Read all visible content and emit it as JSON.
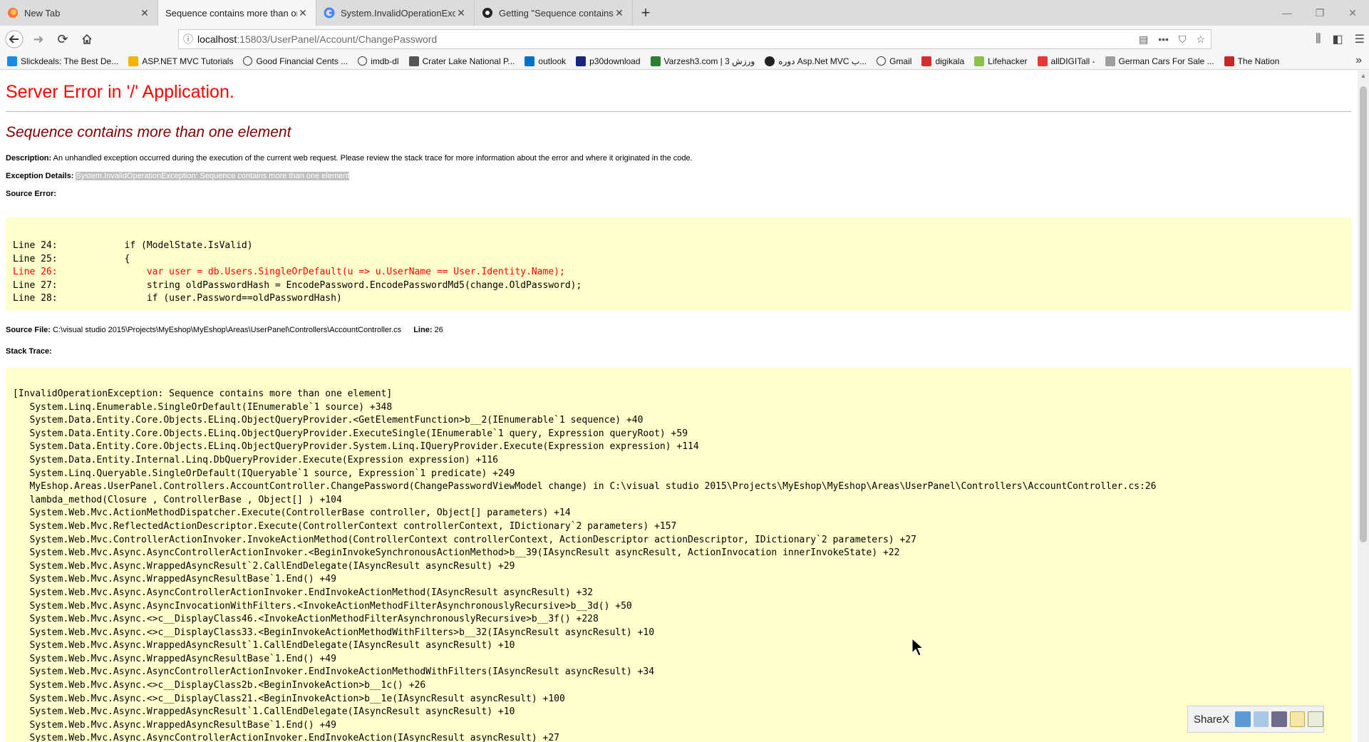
{
  "browser": {
    "tabs": [
      {
        "label": "New Tab",
        "active": false,
        "icon": "firefox-icon"
      },
      {
        "label": "Sequence contains more than one",
        "active": true,
        "icon": "none"
      },
      {
        "label": "System.InvalidOperationExcept",
        "active": false,
        "icon": "google-icon"
      },
      {
        "label": "Getting \"Sequence contains m",
        "active": false,
        "icon": "github-icon"
      }
    ],
    "url_host": "localhost",
    "url_path": ":15803/UserPanel/Account/ChangePassword",
    "bookmarks": [
      {
        "label": "Slickdeals: The Best De...",
        "color": "#1e88e5"
      },
      {
        "label": "ASP.NET MVC Tutorials",
        "color": "#f4b400"
      },
      {
        "label": "Good Financial Cents ...",
        "color": "#333333"
      },
      {
        "label": "imdb-dl",
        "color": "#333333"
      },
      {
        "label": "Crater Lake National P...",
        "color": "#555555"
      },
      {
        "label": "outlook",
        "color": "#0072c6"
      },
      {
        "label": "p30download",
        "color": "#1a237e"
      },
      {
        "label": "Varzesh3.com | ورزش 3",
        "color": "#2e7d32"
      },
      {
        "label": "دوره Asp.Net MVC ب...",
        "color": "#222222"
      },
      {
        "label": "Gmail",
        "color": "#333333"
      },
      {
        "label": "digikala",
        "color": "#d32f2f"
      },
      {
        "label": "Lifehacker",
        "color": "#8bc34a"
      },
      {
        "label": "allDIGITall -",
        "color": "#e53935"
      },
      {
        "label": "German Cars For Sale ...",
        "color": "#9e9e9e"
      },
      {
        "label": "The Nation",
        "color": "#c62828"
      }
    ]
  },
  "error": {
    "title": "Server Error in '/' Application.",
    "message": "Sequence contains more than one element",
    "description_label": "Description:",
    "description_text": "An unhandled exception occurred during the execution of the current web request. Please review the stack trace for more information about the error and where it originated in the code.",
    "exception_label": "Exception Details:",
    "exception_text": "System.InvalidOperationException: Sequence contains more than one element",
    "source_error_label": "Source Error:",
    "source_lines": [
      {
        "text": "Line 24:            if (ModelState.IsValid)",
        "error": false
      },
      {
        "text": "Line 25:            {",
        "error": false
      },
      {
        "text": "Line 26:                var user = db.Users.SingleOrDefault(u => u.UserName == User.Identity.Name);",
        "error": true
      },
      {
        "text": "Line 27:                string oldPasswordHash = EncodePassword.EncodePasswordMd5(change.OldPassword);",
        "error": false
      },
      {
        "text": "Line 28:                if (user.Password==oldPasswordHash)",
        "error": false
      }
    ],
    "source_file_label": "Source File:",
    "source_file_text": "C:\\visual studio 2015\\Projects\\MyEshop\\MyEshop\\Areas\\UserPanel\\Controllers\\AccountController.cs",
    "line_label": "Line:",
    "line_text": "26",
    "stack_label": "Stack Trace:",
    "stack_lines": [
      "[InvalidOperationException: Sequence contains more than one element]",
      "   System.Linq.Enumerable.SingleOrDefault(IEnumerable`1 source) +348",
      "   System.Data.Entity.Core.Objects.ELinq.ObjectQueryProvider.<GetElementFunction>b__2(IEnumerable`1 sequence) +40",
      "   System.Data.Entity.Core.Objects.ELinq.ObjectQueryProvider.ExecuteSingle(IEnumerable`1 query, Expression queryRoot) +59",
      "   System.Data.Entity.Core.Objects.ELinq.ObjectQueryProvider.System.Linq.IQueryProvider.Execute(Expression expression) +114",
      "   System.Data.Entity.Internal.Linq.DbQueryProvider.Execute(Expression expression) +116",
      "   System.Linq.Queryable.SingleOrDefault(IQueryable`1 source, Expression`1 predicate) +249",
      "   MyEshop.Areas.UserPanel.Controllers.AccountController.ChangePassword(ChangePasswordViewModel change) in C:\\visual studio 2015\\Projects\\MyEshop\\MyEshop\\Areas\\UserPanel\\Controllers\\AccountController.cs:26",
      "   lambda_method(Closure , ControllerBase , Object[] ) +104",
      "   System.Web.Mvc.ActionMethodDispatcher.Execute(ControllerBase controller, Object[] parameters) +14",
      "   System.Web.Mvc.ReflectedActionDescriptor.Execute(ControllerContext controllerContext, IDictionary`2 parameters) +157",
      "   System.Web.Mvc.ControllerActionInvoker.InvokeActionMethod(ControllerContext controllerContext, ActionDescriptor actionDescriptor, IDictionary`2 parameters) +27",
      "   System.Web.Mvc.Async.AsyncControllerActionInvoker.<BeginInvokeSynchronousActionMethod>b__39(IAsyncResult asyncResult, ActionInvocation innerInvokeState) +22",
      "   System.Web.Mvc.Async.WrappedAsyncResult`2.CallEndDelegate(IAsyncResult asyncResult) +29",
      "   System.Web.Mvc.Async.WrappedAsyncResultBase`1.End() +49",
      "   System.Web.Mvc.Async.AsyncControllerActionInvoker.EndInvokeActionMethod(IAsyncResult asyncResult) +32",
      "   System.Web.Mvc.Async.AsyncInvocationWithFilters.<InvokeActionMethodFilterAsynchronouslyRecursive>b__3d() +50",
      "   System.Web.Mvc.Async.<>c__DisplayClass46.<InvokeActionMethodFilterAsynchronouslyRecursive>b__3f() +228",
      "   System.Web.Mvc.Async.<>c__DisplayClass33.<BeginInvokeActionMethodWithFilters>b__32(IAsyncResult asyncResult) +10",
      "   System.Web.Mvc.Async.WrappedAsyncResult`1.CallEndDelegate(IAsyncResult asyncResult) +10",
      "   System.Web.Mvc.Async.WrappedAsyncResultBase`1.End() +49",
      "   System.Web.Mvc.Async.AsyncControllerActionInvoker.EndInvokeActionMethodWithFilters(IAsyncResult asyncResult) +34",
      "   System.Web.Mvc.Async.<>c__DisplayClass2b.<BeginInvokeAction>b__1c() +26",
      "   System.Web.Mvc.Async.<>c__DisplayClass21.<BeginInvokeAction>b__1e(IAsyncResult asyncResult) +100",
      "   System.Web.Mvc.Async.WrappedAsyncResult`1.CallEndDelegate(IAsyncResult asyncResult) +10",
      "   System.Web.Mvc.Async.WrappedAsyncResultBase`1.End() +49",
      "   System.Web.Mvc.Async.AsyncControllerActionInvoker.EndInvokeAction(IAsyncResult asyncResult) +27"
    ]
  },
  "sharex": {
    "label": "ShareX"
  },
  "colors": {
    "error_red": "#ff0000",
    "message_maroon": "#800000",
    "code_bg": "#ffffcc"
  }
}
